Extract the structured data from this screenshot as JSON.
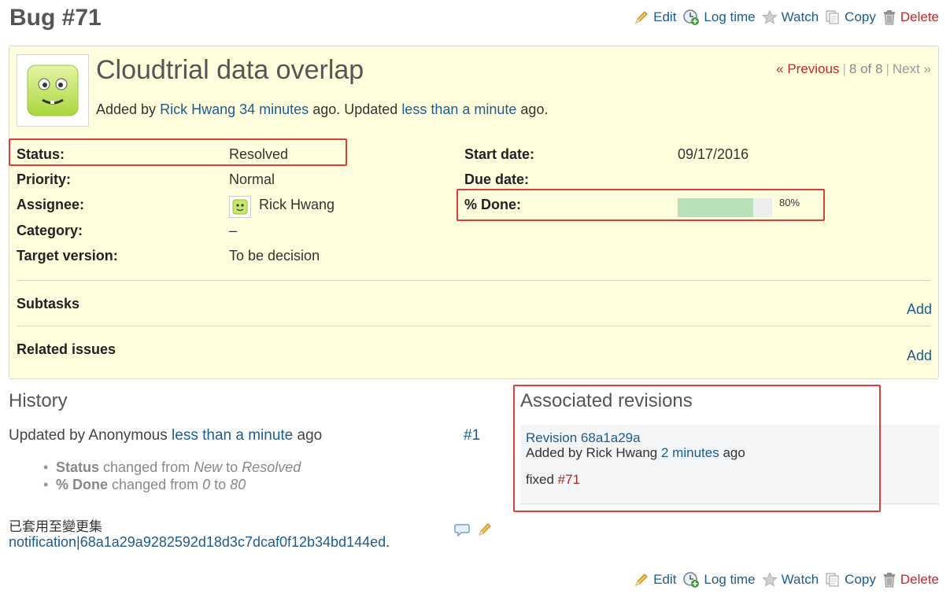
{
  "header": {
    "title": "Bug #71",
    "actions": {
      "edit": "Edit",
      "log_time": "Log time",
      "watch": "Watch",
      "copy": "Copy",
      "delete": "Delete"
    }
  },
  "issue": {
    "subject": "Cloudtrial data overlap",
    "added_prefix": "Added by",
    "author": "Rick Hwang",
    "created_ago": "34 minutes",
    "ago_updated": "ago. Updated",
    "updated_ago": "less than a minute",
    "ago_end": "ago.",
    "nav": {
      "previous": "« Previous",
      "sep": "|",
      "position": "8 of 8",
      "next": "Next »"
    },
    "attributes_left": [
      {
        "label": "Status:",
        "value": "Resolved"
      },
      {
        "label": "Priority:",
        "value": "Normal"
      },
      {
        "label": "Assignee:",
        "value": "Rick Hwang"
      },
      {
        "label": "Category:",
        "value": "–"
      },
      {
        "label": "Target version:",
        "value": "To be decision"
      }
    ],
    "attributes_right": [
      {
        "label": "Start date:",
        "value": "09/17/2016"
      },
      {
        "label": "Due date:",
        "value": ""
      },
      {
        "label": "% Done:",
        "value": "80%"
      }
    ],
    "done_ratio": 0.8,
    "subtasks": {
      "title": "Subtasks",
      "add": "Add"
    },
    "related": {
      "title": "Related issues",
      "add": "Add"
    }
  },
  "history": {
    "title": "History",
    "updated_by": "Updated by Anonymous",
    "updated_ago": "less than a minute",
    "ago": "ago",
    "journal_number": "#1",
    "changes": [
      {
        "field": "Status",
        "text": "changed from",
        "from": "New",
        "to_word": "to",
        "to": "Resolved"
      },
      {
        "field": "% Done",
        "text": "changed from",
        "from": "0",
        "to_word": "to",
        "to": "80"
      }
    ],
    "note_applied": "已套用至變更集",
    "note_changeset": "notification|68a1a29a9282592d18d3c7dcaf0f12b34bd144ed",
    "note_period": "."
  },
  "revisions": {
    "title": "Associated revisions",
    "items": [
      {
        "revision": "Revision 68a1a29a",
        "added_by": "Added by Rick Hwang",
        "ago_link": "2 minutes",
        "ago": "ago",
        "message": "fixed",
        "issue_ref": "#71"
      }
    ]
  },
  "colors": {
    "link": "#1b5c92",
    "delete": "#c1272d",
    "issue_bg": "#ffffdd",
    "progress": "#bae0ba",
    "highlight_box": "#e03c3c"
  }
}
